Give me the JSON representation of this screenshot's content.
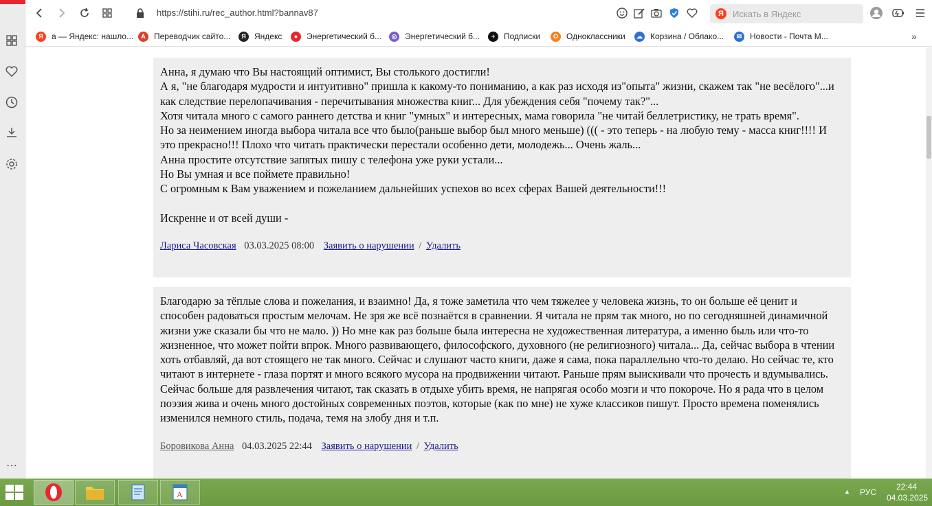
{
  "browser": {
    "url": "https://stihi.ru/rec_author.html?bannav87",
    "search_placeholder": "Искать в Яндекс",
    "search_logo": "Я"
  },
  "bookmarks": [
    {
      "label": "а — Яндекс: нашло...",
      "icon": "Я",
      "color": "#fc3f1d"
    },
    {
      "label": "Переводчик сайто...",
      "icon": "A",
      "color": "#d7412b"
    },
    {
      "label": "Яндекс",
      "icon": "Я",
      "color": "#222222"
    },
    {
      "label": "Энергетический б...",
      "icon": "●",
      "color": "#e8262f"
    },
    {
      "label": "Энергетический б...",
      "icon": "◎",
      "color": "#7a5cc9"
    },
    {
      "label": "Подписки",
      "icon": "+",
      "color": "#111111"
    },
    {
      "label": "Одноклассники",
      "icon": "О",
      "color": "#f58220"
    },
    {
      "label": "Корзина / Облако...",
      "icon": "☁",
      "color": "#2c6fd6"
    },
    {
      "label": "Новости - Почта М...",
      "icon": "✉",
      "color": "#2c6fd6"
    }
  ],
  "comments": [
    {
      "lines": [
        "Анна, я думаю что Вы настоящий оптимист, Вы столького достигли!",
        "А я, \"не благодаря мудрости и интуитивно\" пришла к какому-то пониманию, а как раз исходя из\"опыта\" жизни, скажем так \"не весёлого\"...и как следствие перелопачивания - перечитывания множества книг... Для убеждения себя \"почему так?\"...",
        "Хотя читала много с самого раннего детства и книг \"умных\" и интересных, мама говорила \"не читай беллетристику, не трать время\".",
        "Но за неимением иногда выбора читала все что было(раньше выбор был много меньше) ((( - это теперь - на любую тему - масса книг!!!! И это прекрасно!!! Плохо что читать практически перестали особенно дети, молодежь... Очень жаль...",
        "Анна простите отсутствие запятых пишу с телефона уже руки устали...",
        "Но Вы умная и все поймете правильно!",
        "С огромным к Вам уважением и пожеланием дальнейших успехов во всех сферах Вашей деятельности!!!",
        "",
        "Искренне и от всей души -"
      ],
      "author": "Лариса Часовская",
      "date": "03.03.2025 08:00",
      "report": "Заявить о нарушении",
      "separator": "/",
      "delete": "Удалить"
    },
    {
      "lines": [
        "Благодарю за тёплые слова и пожелания, и взаимно! Да, я тоже заметила что чем тяжелее у человека жизнь, то он больше её ценит и способен радоваться простым мелочам. Не зря же всё познаётся в сравнении. Я читала не прям так много, но по сегодняшней динамичной жизни уже сказали бы что не мало. )) Но мне как раз больше была интересна не художественная литература, а именно быль или что-то жизненное, что может пойти впрок. Много развивающего, философского, духовного (не религиозного) читала... Да, сейчас выбора в чтении хоть отбавляй, да вот стоящего не так много. Сейчас и слушают часто книги, даже я сама, пока параллельно что-то делаю. Но сейчас те, кто читают в интернете - глаза портят и много всякого мусора на продвижении читают. Раньше прям выискивали что прочесть и вдумывались. Сейчас больше для развлечения читают, так сказать в отдыхе убить время, не напрягая особо мозги и что покороче. Но я рада что в целом поэзия жива и очень много достойных современных поэтов, которые (как по мне) не хуже классиков пишут. Просто времена поменялись изменился немного стиль, подача, темя на злобу дня и т.п."
      ],
      "author": "Боровикова Анна",
      "date": "04.03.2025 22:44",
      "report": "Заявить о нарушении",
      "separator": "/",
      "delete": "Удалить"
    }
  ],
  "taskbar": {
    "lang": "РУС",
    "time": "22:44",
    "date": "04.03.2025",
    "tray_arrow": "▲"
  }
}
